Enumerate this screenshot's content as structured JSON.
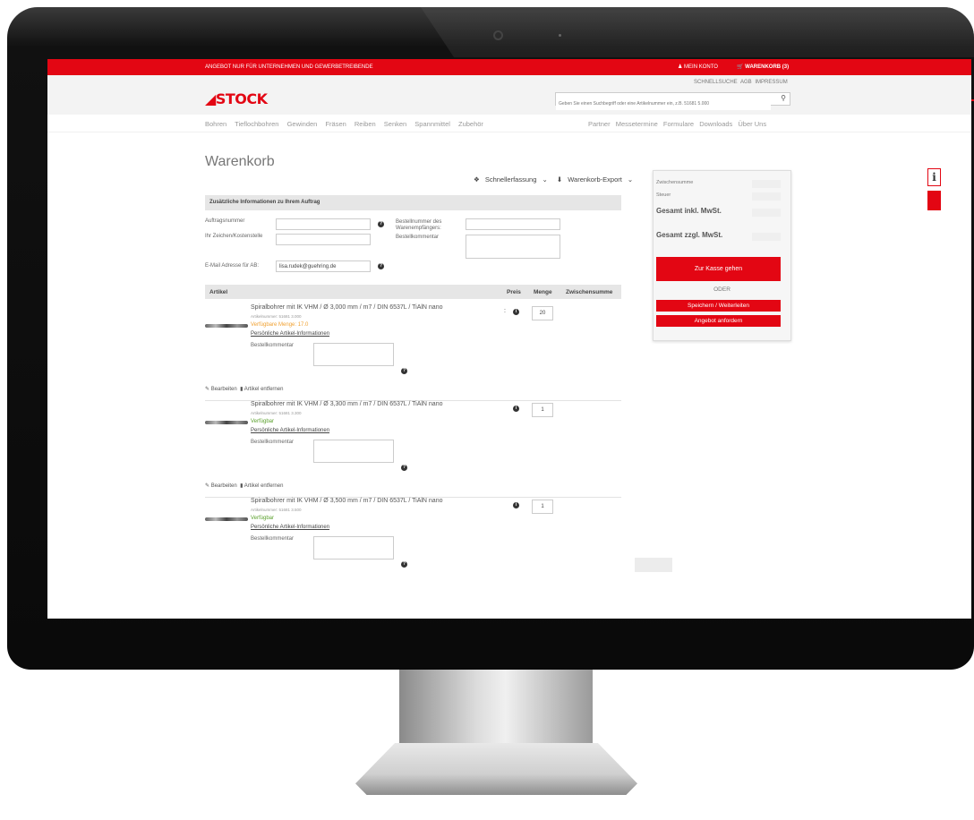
{
  "topbar": {
    "notice": "ANGEBOT NUR FÜR UNTERNEHMEN UND GEWERBETREIBENDE",
    "account": "MEIN KONTO",
    "cart": "WARENKORB (3)"
  },
  "header": {
    "links": "SCHNELLSUCHE   AGB   IMPRESSUM",
    "logo": "STOCK",
    "search_placeholder": "Geben Sie einen Suchbegriff oder eine Artikelnummer ein, z.B. 51681 5.000"
  },
  "nav": {
    "left": [
      "Bohren",
      "Tieflochbohren",
      "Gewinden",
      "Fräsen",
      "Reiben",
      "Senken",
      "Spannmittel",
      "Zubehör"
    ],
    "right": [
      "Partner",
      "Messetermine",
      "Formulare",
      "Downloads",
      "Über Uns"
    ]
  },
  "page": {
    "title": "Warenkorb",
    "quick_entry": "Schnellerfassung",
    "export": "Warenkorb-Export"
  },
  "order_info": {
    "heading": "Zusätzliche Informationen zu Ihrem Auftrag",
    "order_number_label": "Auftragsnummer",
    "reference_label": "Ihr Zeichen/Kostenstelle",
    "email_label": "E-Mail Adresse für AB:",
    "email_value": "lisa.rudek@guehring.de",
    "recipient_order_label": "Bestellnummer des Warenempfängers:",
    "order_comment_label": "Bestellkommentar"
  },
  "table": {
    "col_article": "Artikel",
    "col_price": "Preis",
    "col_qty": "Menge",
    "col_subtotal": "Zwischensumme"
  },
  "items": [
    {
      "title": "Spiralbohrer mit IK VHM / Ø 3,000 mm / m7 / DIN 6537L / TiAlN nano",
      "article_number": "Artikelnummer: 51681 3.000",
      "availability": "Verfügbare Menge: 17.0",
      "availability_color": "#f0a030",
      "personal_info": "Persönliche Artikel-Informationen",
      "comment_label": "Bestellkommentar",
      "price_mark": ":",
      "quantity": "20",
      "edit": "Bearbeiten",
      "remove": "Artikel entfernen"
    },
    {
      "title": "Spiralbohrer mit IK VHM / Ø 3,300 mm / m7 / DIN 6537L / TiAlN nano",
      "article_number": "Artikelnummer: 51681 3.300",
      "availability": "Verfügbar",
      "availability_color": "#5aa02c",
      "personal_info": "Persönliche Artikel-Informationen",
      "comment_label": "Bestellkommentar",
      "quantity": "1",
      "edit": "Bearbeiten",
      "remove": "Artikel entfernen"
    },
    {
      "title": "Spiralbohrer mit IK VHM / Ø 3,500 mm / m7 / DIN 6537L / TiAlN nano",
      "article_number": "Artikelnummer: 51681 3.500",
      "availability": "Verfügbar",
      "availability_color": "#5aa02c",
      "personal_info": "Persönliche Artikel-Informationen",
      "comment_label": "Bestellkommentar",
      "quantity": "1"
    }
  ],
  "summary": {
    "subtotal_label": "Zwischensumme",
    "tax_label": "Steuer",
    "total_gross_label": "Gesamt inkl. MwSt.",
    "total_net_label": "Gesamt zzgl. MwSt.",
    "checkout": "Zur Kasse gehen",
    "or": "ODER",
    "save_forward": "Speichern / Weiterleiten",
    "request_quote": "Angebot anfordern"
  },
  "side": {
    "info_glyph": "i"
  },
  "colors": {
    "brand_red": "#e30613"
  }
}
